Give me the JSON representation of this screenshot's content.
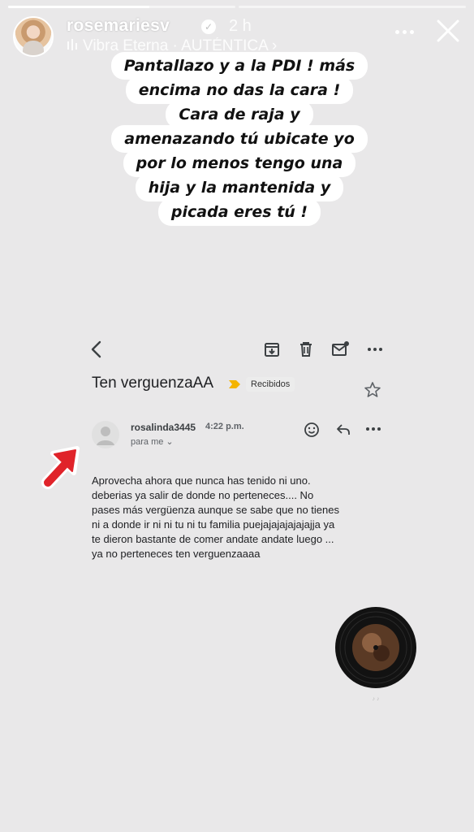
{
  "progress": [
    {
      "fill": 0.62
    },
    {
      "fill": 0
    }
  ],
  "header": {
    "username": "rosemariesv",
    "time_ago": "2 h",
    "music": "Vibra Eterna · AUTÉNTICA ›",
    "verified_icon": "verified-badge-icon",
    "more_icon": "more-horizontal-icon",
    "close_icon": "close-icon"
  },
  "caption": {
    "lines": [
      "Pantallazo y a la PDI ! más",
      "encima no das la cara !",
      "Cara de raja y",
      "amenazando tú ubicate yo",
      "por lo menos tengo una",
      "hija y la mantenida y",
      "picada eres tú !"
    ]
  },
  "email": {
    "subject": "Ten verguenzaAA",
    "label": "Recibidos",
    "sender": "rosalinda3445",
    "time": "4:22 p.m.",
    "recipient": "para me ⌄",
    "body_lines": [
      "Aprovecha ahora que nunca has tenido ni uno.",
      "deberias ya salir de donde no perteneces.... No",
      "pases más vergüenza aunque se sabe que no tienes",
      "ni a donde ir ni ni tu ni tu familia puejajajajajajajja ya",
      "te dieron bastante de comer andate andate luego ...",
      "ya no perteneces ten verguenzaaaa"
    ]
  },
  "colors": {
    "background": "#e9e8e9",
    "label_arrow": "#f4b400",
    "red_arrow": "#e0232a"
  }
}
